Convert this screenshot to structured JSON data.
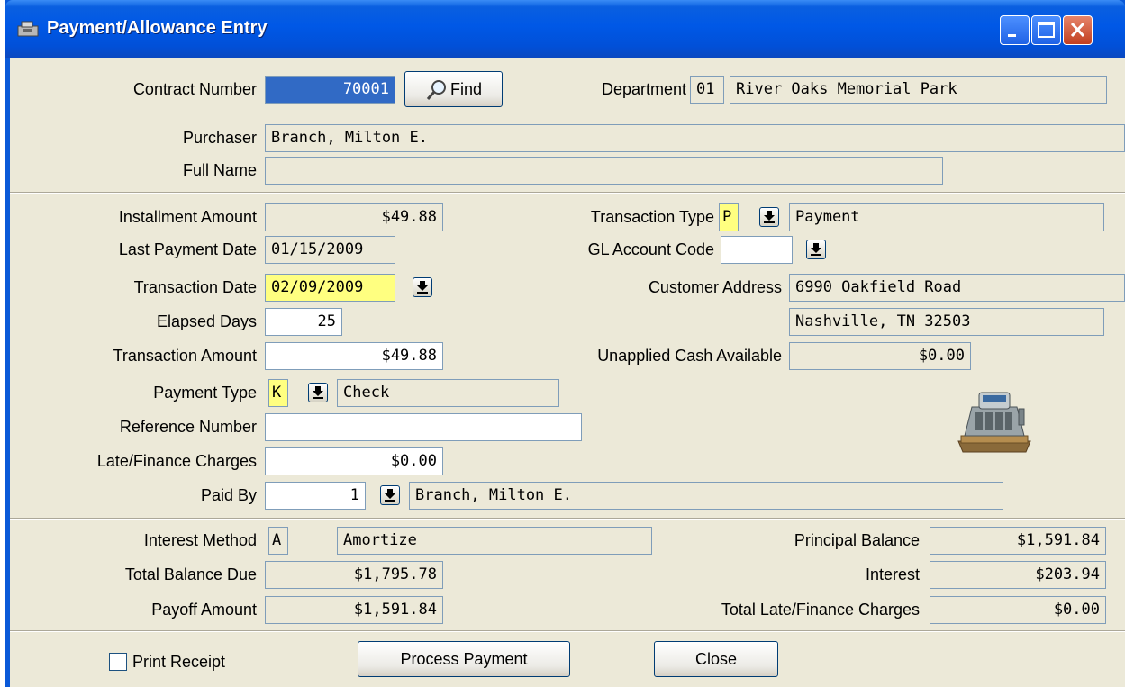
{
  "window": {
    "title": "Payment/Allowance Entry",
    "icons": [
      "cash-register-icon",
      "minimize-icon",
      "maximize-icon",
      "close-icon"
    ]
  },
  "header": {
    "contract_number_label": "Contract Number",
    "contract_number_value": "70001",
    "find_button_label": "Find",
    "department_label": "Department",
    "department_code": "01",
    "department_name": "River Oaks Memorial Park",
    "purchaser_label": "Purchaser",
    "purchaser_value": "Branch, Milton E.",
    "full_name_label": "Full Name",
    "full_name_value": ""
  },
  "payment": {
    "installment_amount_label": "Installment Amount",
    "installment_amount_value": "$49.88",
    "last_payment_date_label": "Last Payment Date",
    "last_payment_date_value": "01/15/2009",
    "transaction_date_label": "Transaction Date",
    "transaction_date_value": "02/09/2009",
    "elapsed_days_label": "Elapsed Days",
    "elapsed_days_value": "25",
    "transaction_amount_label": "Transaction Amount",
    "transaction_amount_value": "$49.88",
    "payment_type_label": "Payment Type",
    "payment_type_code": "K",
    "payment_type_desc": "Check",
    "reference_number_label": "Reference Number",
    "reference_number_value": "",
    "late_finance_label": "Late/Finance Charges",
    "late_finance_value": "$0.00",
    "paid_by_label": "Paid By",
    "paid_by_number": "1",
    "paid_by_name": "Branch, Milton E.",
    "transaction_type_label": "Transaction Type",
    "transaction_type_code": "P",
    "transaction_type_desc": "Payment",
    "gl_account_label": "GL Account Code",
    "gl_account_value": "",
    "customer_address_label": "Customer Address",
    "customer_address_line1": "6990 Oakfield Road",
    "customer_address_line2": "Nashville, TN 32503",
    "unapplied_cash_label": "Unapplied Cash Available",
    "unapplied_cash_value": "$0.00"
  },
  "balances": {
    "interest_method_label": "Interest Method",
    "interest_method_code": "A",
    "interest_method_desc": "Amortize",
    "total_balance_due_label": "Total Balance Due",
    "total_balance_due_value": "$1,795.78",
    "payoff_amount_label": "Payoff Amount",
    "payoff_amount_value": "$1,591.84",
    "principal_balance_label": "Principal Balance",
    "principal_balance_value": "$1,591.84",
    "interest_label": "Interest",
    "interest_value": "$203.94",
    "total_late_finance_label": "Total Late/Finance Charges",
    "total_late_finance_value": "$0.00"
  },
  "footer": {
    "print_receipt_label": "Print Receipt",
    "print_receipt_checked": false,
    "process_payment_label": "Process Payment",
    "close_label": "Close"
  },
  "colors": {
    "title_bar": "#0058e6",
    "dialog_bg": "#ece9d8",
    "required_field": "#ffff80",
    "selection": "#316ac5"
  }
}
